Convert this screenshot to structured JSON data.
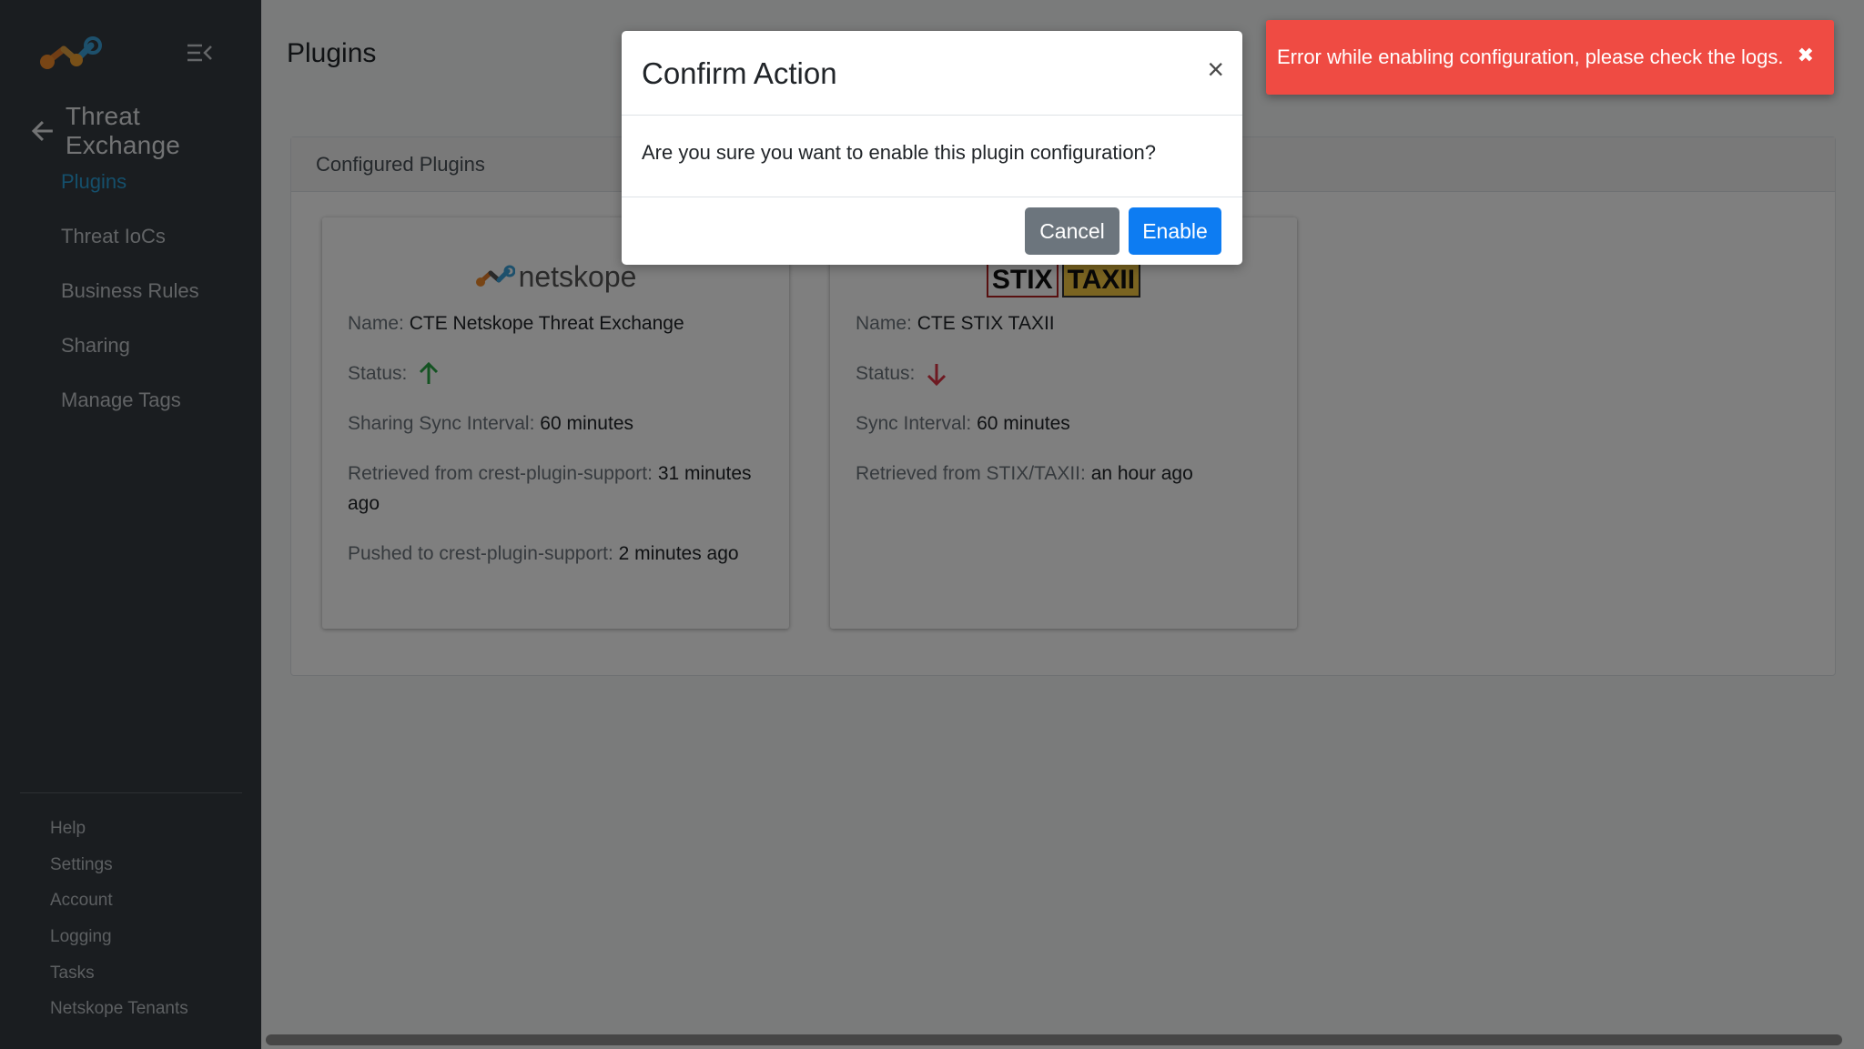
{
  "sidebar": {
    "section_title": "Threat Exchange",
    "nav": [
      {
        "label": "Plugins",
        "active": true
      },
      {
        "label": "Threat IoCs"
      },
      {
        "label": "Business Rules"
      },
      {
        "label": "Sharing"
      },
      {
        "label": "Manage Tags"
      }
    ],
    "bottom": [
      "Help",
      "Settings",
      "Account",
      "Logging",
      "Tasks",
      "Netskope Tenants"
    ]
  },
  "main": {
    "page_title": "Plugins",
    "panel_title": "Configured Plugins",
    "cards": [
      {
        "logo_text": "netskope",
        "name_label": "Name:",
        "name_value": "CTE Netskope Threat Exchange",
        "status_label": "Status:",
        "status": "up",
        "sync_label": "Sharing Sync Interval:",
        "sync_value": "60 minutes",
        "retrieved_label": "Retrieved from crest-plugin-support:",
        "retrieved_value": "31 minutes ago",
        "pushed_label": "Pushed to crest-plugin-support:",
        "pushed_value": "2 minutes ago"
      },
      {
        "logo_text": "STIX TAXII",
        "name_label": "Name:",
        "name_value": "CTE STIX TAXII",
        "status_label": "Status:",
        "status": "down",
        "sync_label": "Sync Interval:",
        "sync_value": "60 minutes",
        "retrieved_label": "Retrieved from STIX/TAXII:",
        "retrieved_value": "an hour ago"
      }
    ]
  },
  "modal": {
    "title": "Confirm Action",
    "close_glyph": "×",
    "body": "Are you sure you want to enable this plugin configuration?",
    "cancel_label": "Cancel",
    "enable_label": "Enable"
  },
  "toast": {
    "message": "Error while enabling configuration, please check the logs.",
    "close_glyph": "✖"
  },
  "colors": {
    "sidebar_bg": "#343a40",
    "active_nav": "#2a9fd6",
    "primary": "#0d7cf2",
    "secondary": "#6c757d",
    "error": "#ef4b43",
    "status_up": "#28a745",
    "status_down": "#dc3545"
  }
}
